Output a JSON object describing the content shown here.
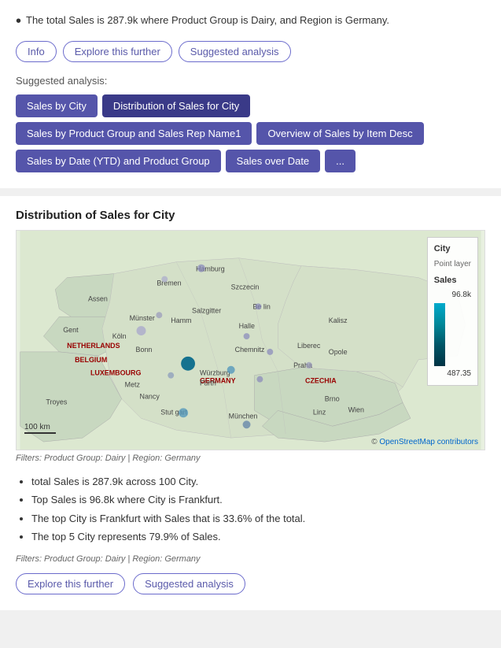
{
  "top": {
    "bullet_text": "The total Sales is 287.9k where Product Group is Dairy, and Region is Germany.",
    "buttons": {
      "info": "Info",
      "explore": "Explore this further",
      "suggested": "Suggested analysis"
    },
    "suggested_label": "Suggested analysis:",
    "analysis_buttons": [
      "Sales by City",
      "Distribution of Sales for City",
      "Sales by Product Group and Sales Rep Name1",
      "Overview of Sales by Item Desc",
      "Sales by Date (YTD) and Product Group",
      "Sales over Date",
      "..."
    ]
  },
  "bottom": {
    "chart_title": "Distribution of Sales for City",
    "legend": {
      "city_label": "City",
      "point_layer": "Point layer",
      "sales_label": "Sales",
      "max_value": "96.8k",
      "min_value": "487.35"
    },
    "filter_text": "Filters: Product Group: Dairy | Region: Germany",
    "insights": [
      "total Sales is 287.9k across 100 City.",
      "Top Sales is 96.8k where City is Frankfurt.",
      "The top City is Frankfurt with Sales that is 33.6% of the total.",
      "The top 5 City represents 79.9% of Sales."
    ],
    "filter_text2": "Filters: Product Group: Dairy | Region: Germany",
    "explore_btn": "Explore this further",
    "suggested_btn": "Suggested analysis"
  }
}
